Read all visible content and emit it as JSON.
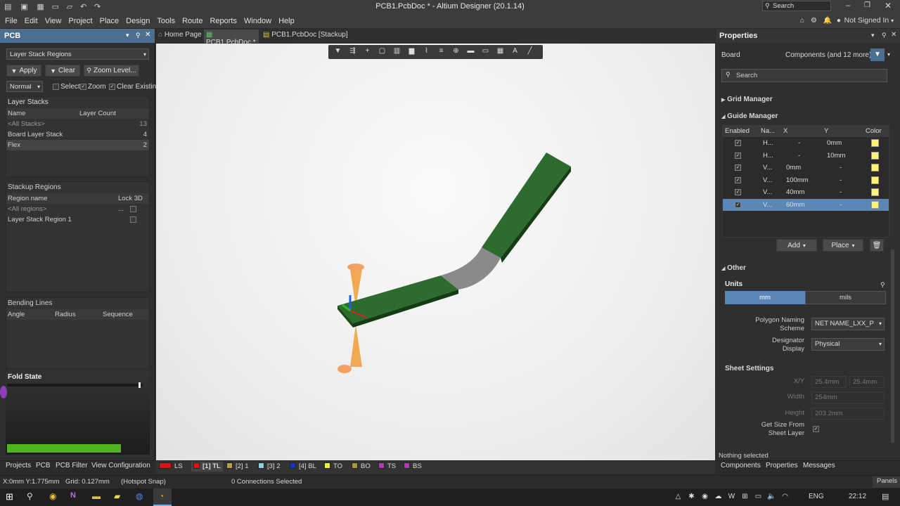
{
  "window": {
    "title": "PCB1.PcbDoc * - Altium Designer (20.1.14)",
    "search_placeholder": "Search",
    "user": "Not Signed In"
  },
  "menu": [
    "File",
    "Edit",
    "View",
    "Project",
    "Place",
    "Design",
    "Tools",
    "Route",
    "Reports",
    "Window",
    "Help"
  ],
  "tabs": [
    {
      "label": "Home Page"
    },
    {
      "label": "PCB1.PcbDoc *"
    },
    {
      "label": "PCB1.PcbDoc [Stackup]"
    }
  ],
  "left_panel": {
    "title": "PCB",
    "mode": "Layer Stack Regions",
    "apply": "Apply",
    "clear": "Clear",
    "zoom_level": "Zoom Level...",
    "normal": "Normal",
    "select": "Select",
    "zoom": "Zoom",
    "clear_existing": "Clear Existing",
    "layer_stacks": {
      "title": "Layer Stacks",
      "col_name": "Name",
      "col_count": "Layer Count",
      "rows": [
        {
          "name": "<All Stacks>",
          "count": "13"
        },
        {
          "name": "Board Layer Stack",
          "count": "4"
        },
        {
          "name": "Flex",
          "count": "2"
        }
      ]
    },
    "stackup_regions": {
      "title": "Stackup Regions",
      "col_name": "Region name",
      "col_lock": "Lock 3D ...",
      "rows": [
        {
          "name": "<All regions>"
        },
        {
          "name": "Layer Stack Region 1"
        }
      ]
    },
    "bending_lines": {
      "title": "Bending Lines",
      "col_angle": "Angle",
      "col_radius": "Radius",
      "col_sequence": "Sequence"
    },
    "fold_state": {
      "title": "Fold State",
      "level": 0
    }
  },
  "bottom_tabs": [
    "Projects",
    "PCB",
    "PCB Filter",
    "View Configuration"
  ],
  "layers": [
    {
      "label": "LS",
      "color": "#e01010"
    },
    {
      "label": "[1] TL",
      "color": "#e01010"
    },
    {
      "label": "[2] 1",
      "color": "#c0a030"
    },
    {
      "label": "[3] 2",
      "color": "#8ad0e0"
    },
    {
      "label": "[4] BL",
      "color": "#1030e0"
    },
    {
      "label": "TO",
      "color": "#f0f030"
    },
    {
      "label": "BO",
      "color": "#a0a020"
    },
    {
      "label": "TS",
      "color": "#c030c0"
    },
    {
      "label": "BS",
      "color": "#c030c0"
    }
  ],
  "status": {
    "coords": "X:0mm Y:1.775mm",
    "grid": "Grid: 0.127mm",
    "snap": "(Hotspot Snap)",
    "connections": "0 Connections Selected",
    "panels": "Panels"
  },
  "properties": {
    "title": "Properties",
    "board": "Board",
    "components": "Components (and 12 more)",
    "search": "Search",
    "grid_manager": "Grid Manager",
    "guide_manager": "Guide Manager",
    "cols": {
      "enabled": "Enabled",
      "name": "Na...",
      "x": "X",
      "y": "Y",
      "color": "Color"
    },
    "guides": [
      {
        "name": "H...",
        "x": "-",
        "y": "0mm"
      },
      {
        "name": "H...",
        "x": "-",
        "y": "10mm"
      },
      {
        "name": "V...",
        "x": "0mm",
        "y": "-"
      },
      {
        "name": "V...",
        "x": "100mm",
        "y": "-"
      },
      {
        "name": "V...",
        "x": "40mm",
        "y": "-"
      },
      {
        "name": "V...",
        "x": "60mm",
        "y": "-"
      }
    ],
    "add": "Add",
    "place": "Place",
    "other": "Other",
    "units": "Units",
    "mm": "mm",
    "mils": "mils",
    "polygon_naming_label": "Polygon Naming Scheme",
    "polygon_naming_value": "NET NAME_LXX_PXX",
    "designator_label": "Designator Display",
    "designator_value": "Physical",
    "sheet_settings": "Sheet Settings",
    "xy_label": "X/Y",
    "x_value": "25.4mm",
    "y_value": "25.4mm",
    "width_label": "Width",
    "width_value": "254mm",
    "height_label": "Height",
    "height_value": "203.2mm",
    "size_from_label": "Get Size From Sheet Layer",
    "nothing_selected": "Nothing selected"
  },
  "right_tabs": [
    "Components",
    "Properties",
    "Messages"
  ],
  "taskbar": {
    "lang": "ENG",
    "time": "22:12"
  }
}
